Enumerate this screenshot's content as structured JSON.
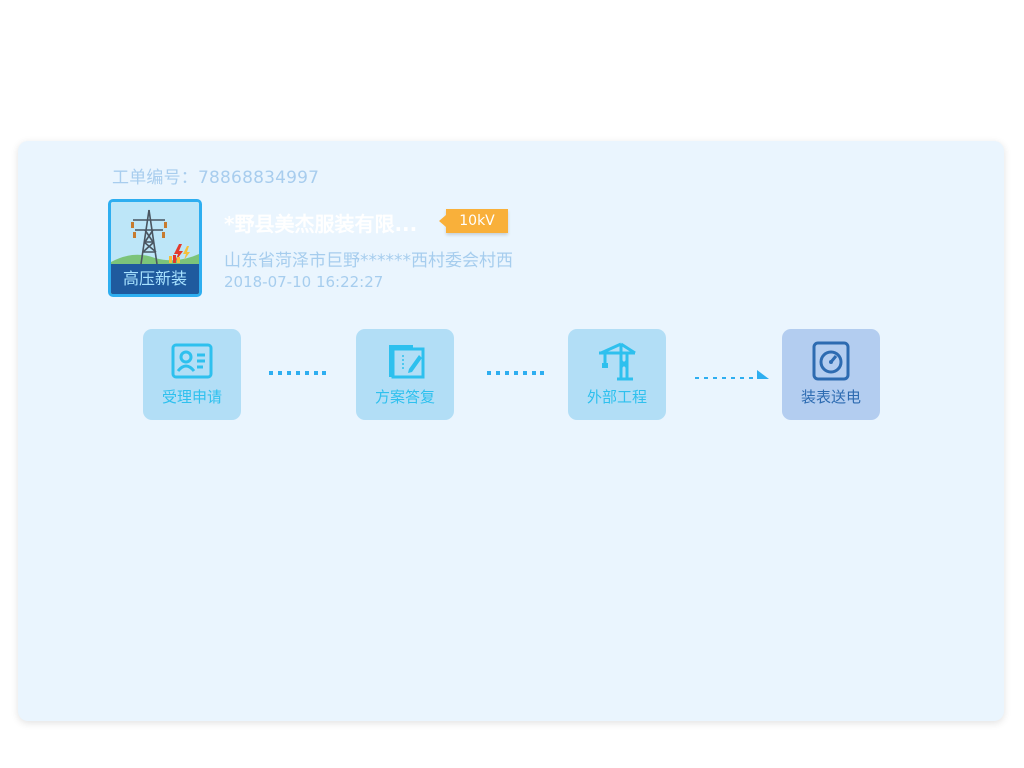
{
  "order": {
    "label": "工单编号：",
    "number": "78868834997"
  },
  "thumbnail": {
    "caption": "高压新装",
    "icon": "power-tower-icon"
  },
  "customer": {
    "name": "*野县美杰服装有限...",
    "voltage": "10kV",
    "address": "山东省菏泽市巨野******西村委会村西",
    "datetime": "2018-07-10 16:22:27"
  },
  "steps": [
    {
      "label": "受理申请",
      "icon": "id-card-icon",
      "active": false
    },
    {
      "label": "方案答复",
      "icon": "edit-document-icon",
      "active": false
    },
    {
      "label": "外部工程",
      "icon": "tower-crane-icon",
      "active": false
    },
    {
      "label": "装表送电",
      "icon": "meter-gauge-icon",
      "active": true
    }
  ],
  "colors": {
    "card_bg": "#eaf5fe",
    "accent": "#2eaef0",
    "step_bg": "#b2def6",
    "step_active_bg": "#b3cdf0",
    "voltage_badge": "#f9b03a"
  }
}
